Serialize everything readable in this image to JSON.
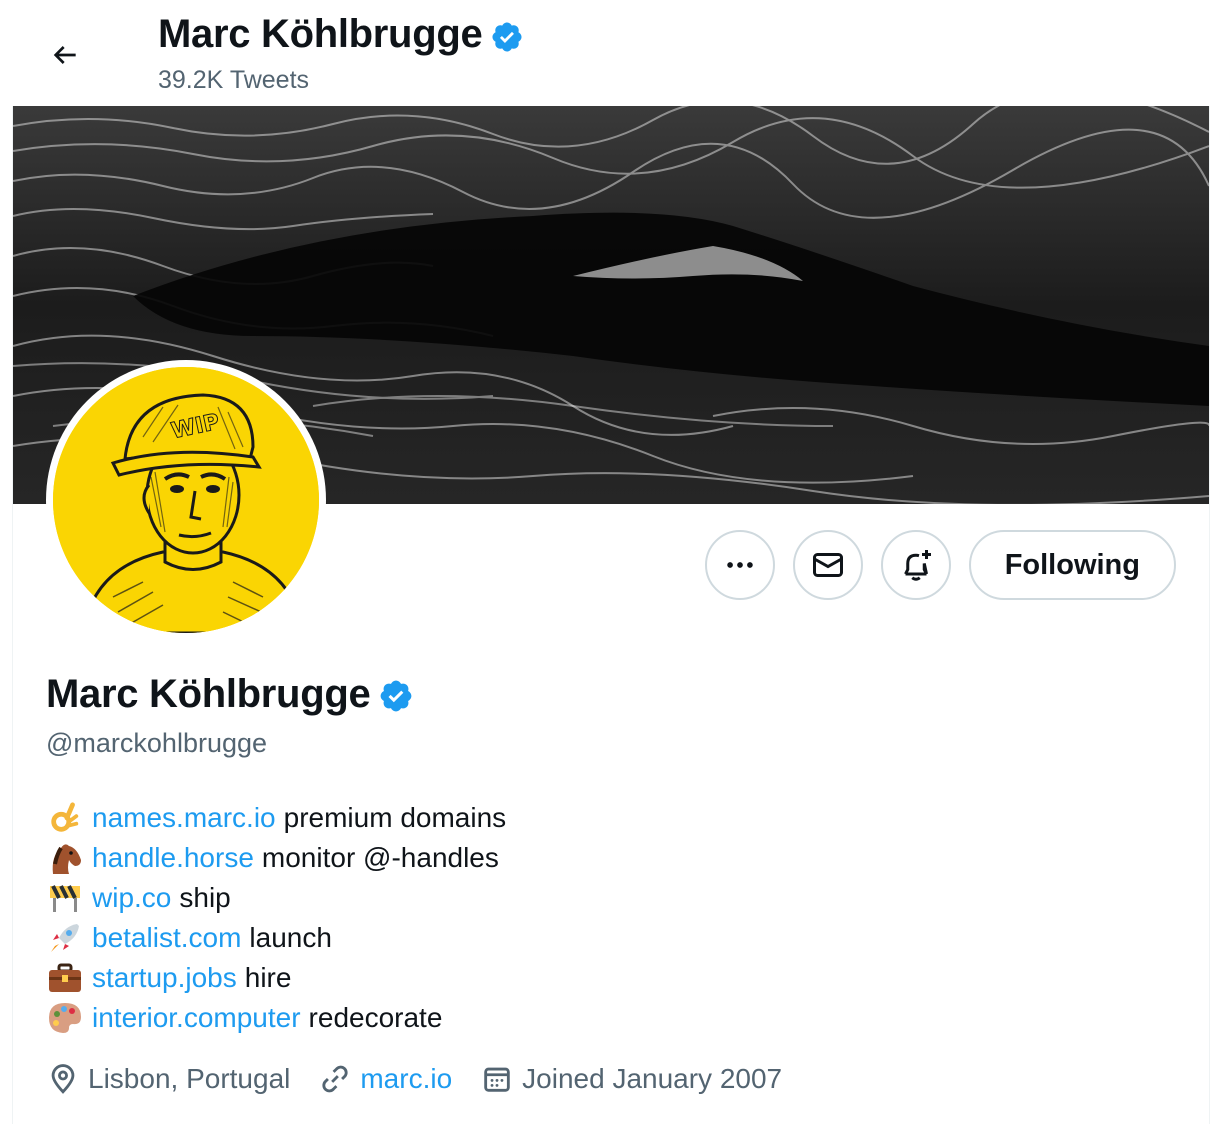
{
  "header": {
    "back_icon": "arrow-left-icon",
    "display_name": "Marc Köhlbrugge",
    "tweet_count": "39.2K Tweets"
  },
  "colors": {
    "accent": "#1d9bf0",
    "text": "#0f1419",
    "muted": "#536471",
    "avatar_bg": "#fad503"
  },
  "actions": {
    "more_icon": "more-icon",
    "message_icon": "envelope-icon",
    "notify_icon": "bell-plus-icon",
    "follow_label": "Following"
  },
  "profile": {
    "display_name": "Marc Köhlbrugge",
    "handle": "@marckohlbrugge",
    "verified_icon": "verified-badge-icon",
    "avatar_cap_text": "WIP"
  },
  "bio": [
    {
      "icon": "ok-hand-icon",
      "link": "names.marc.io",
      "text": "premium domains"
    },
    {
      "icon": "horse-icon",
      "link": "handle.horse",
      "text": "monitor @-handles"
    },
    {
      "icon": "construction-icon",
      "link": "wip.co",
      "text": "ship"
    },
    {
      "icon": "rocket-icon",
      "link": "betalist.com",
      "text": "launch"
    },
    {
      "icon": "briefcase-icon",
      "link": "startup.jobs",
      "text": "hire"
    },
    {
      "icon": "palette-icon",
      "link": "interior.computer",
      "text": "redecorate"
    }
  ],
  "meta": {
    "location": "Lisbon, Portugal",
    "website": "marc.io",
    "joined": "Joined January 2007"
  }
}
